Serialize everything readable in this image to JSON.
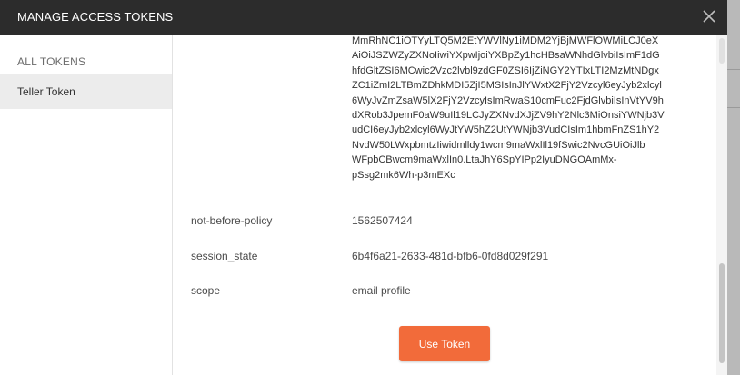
{
  "modal": {
    "title": "MANAGE ACCESS TOKENS",
    "close_icon": "close-icon"
  },
  "sidebar": {
    "heading": "ALL TOKENS",
    "items": [
      {
        "label": "Teller Token",
        "selected": true
      }
    ]
  },
  "token": {
    "lines": [
      "MmRhNC1iOTYyLTQ5M2EtYWVlNy1iMDM2YjBjMWFlOWMiLCJ0eX",
      "AiOiJSZWZyZXNoIiwiYXpwIjoiYXBpZy1hcHBsaWNhdGlvbiIsImF1dG",
      "hfdGltZSI6MCwic2Vzc2lvbl9zdGF0ZSI6IjZiNGY2YTIxLTI2MzMtNDgx",
      "ZC1iZmI2LTBmZDhkMDI5ZjI5MSIsInJlYWxtX2FjY2Vzcyl6eyJyb2xlcyl",
      "6WyJvZmZsaW5lX2FjY2VzcyIsImRwaS10cmFuc2FjdGlvbiIsInVtYV9h",
      "dXRob3JpemF0aW9uIl19LCJyZXNvdXJjZV9hY2Nlc3MiOnsiYWNjb3V",
      "udCI6eyJyb2xlcyl6WyJtYW5hZ2UtYWNjb3VudCIsIm1hbmFnZS1hY2",
      "NvdW50LWxpbmtzIiwidmlldy1wcm9maWxlIl19fSwic2NvcGUiOiJlb",
      "WFpbCBwcm9maWxlIn0.LtaJhY6SpYIPp2IyuDNGOAmMx-",
      "pSsg2mk6Wh-p3mEXc"
    ]
  },
  "rows": [
    {
      "label": "not-before-policy",
      "value": "1562507424"
    },
    {
      "label": "session_state",
      "value": "6b4f6a21-2633-481d-bfb6-0fd8d029f291"
    },
    {
      "label": "scope",
      "value": "email profile"
    }
  ],
  "actions": {
    "use_token_label": "Use Token"
  },
  "colors": {
    "header_bg": "#2c2c2c",
    "accent": "#f26b3a",
    "selected_item_bg": "#ececec"
  }
}
